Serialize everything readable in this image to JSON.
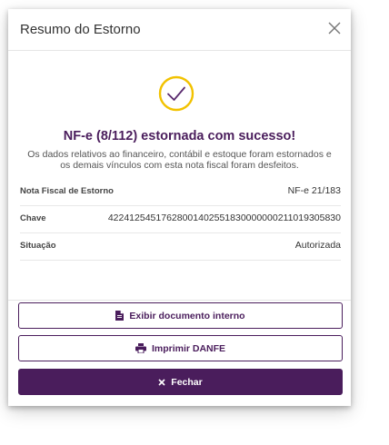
{
  "modal": {
    "title": "Resumo do Estorno",
    "close_icon": "close-icon"
  },
  "success": {
    "icon": "check-circle-icon",
    "title": "NF-e (8/112) estornada com sucesso!",
    "description_line1": "Os dados relativos ao financeiro, contábil e estoque foram estornados e",
    "description_line2": "os demais vínculos com esta nota fiscal foram desfeitos."
  },
  "details": [
    {
      "label": "Nota Fiscal de Estorno",
      "value": "NF-e 21/183"
    },
    {
      "label": "Chave",
      "value": "42241254517628001402551830000000211019305830"
    },
    {
      "label": "Situação",
      "value": "Autorizada"
    }
  ],
  "actions": {
    "view_document_label": "Exibir documento interno",
    "view_document_icon": "file-icon",
    "print_label": "Imprimir DANFE",
    "print_icon": "printer-icon",
    "close_label": "Fechar",
    "close_button_icon": "x-icon"
  },
  "colors": {
    "primary": "#4a1d5c",
    "success_ring": "#f2c200",
    "check": "#5a2a6e"
  }
}
